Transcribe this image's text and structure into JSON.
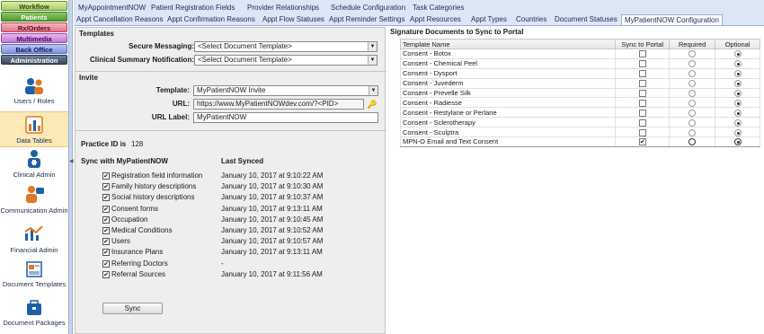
{
  "nav": {
    "tabs": [
      "Workflow",
      "Patients",
      "Rx/Orders",
      "Multimedia",
      "Back Office",
      "Administration"
    ],
    "items": [
      {
        "label": "Users / Roles",
        "icon": "users-icon"
      },
      {
        "label": "Data Tables",
        "icon": "data-tables-icon"
      },
      {
        "label": "Clinical Admin",
        "icon": "clinical-admin-icon"
      },
      {
        "label": "Communication Admin",
        "icon": "communication-admin-icon"
      },
      {
        "label": "Financial Admin",
        "icon": "financial-admin-icon"
      },
      {
        "label": "Document Templates",
        "icon": "document-templates-icon"
      },
      {
        "label": "Document Packages",
        "icon": "document-packages-icon"
      }
    ]
  },
  "tabs": {
    "row1": [
      "MyAppointmentNOW",
      "Patient Registration Fields",
      "Provider Relationships",
      "Schedule Configuration",
      "Task Categories"
    ],
    "row2": [
      "Appt Cancellation Reasons",
      "Appt Confirmation Reasons",
      "Appt Flow Statuses",
      "Appt Reminder Settings",
      "Appt Resources",
      "Appt Types",
      "Countries",
      "Document Statuses",
      "MyPatientNOW Configuration"
    ]
  },
  "templates": {
    "heading": "Templates",
    "secure_label": "Secure Messaging:",
    "secure_value": "<Select Document Template>",
    "summary_label": "Clinical Summary Notification:",
    "summary_value": "<Select Document Template>"
  },
  "invite": {
    "heading": "Invite",
    "template_label": "Template:",
    "template_value": "MyPatientNOW Invite",
    "url_label": "URL:",
    "url_value": "https://www.MyPatientNOWdev.com/?<PID>",
    "urllabel_label": "URL Label:",
    "urllabel_value": "MyPatientNOW"
  },
  "practice": {
    "label": "Practice ID is",
    "value": "128"
  },
  "sync": {
    "col_header": "Sync with MyPatientNOW",
    "last_header": "Last Synced",
    "items": [
      {
        "name": "Registration field information",
        "checked": true,
        "last": "January 10, 2017 at 9:10:22 AM"
      },
      {
        "name": "Family history descriptions",
        "checked": true,
        "last": "January 10, 2017 at 9:10:30 AM"
      },
      {
        "name": "Social history descriptions",
        "checked": true,
        "last": "January 10, 2017 at 9:10:37 AM"
      },
      {
        "name": "Consent forms",
        "checked": true,
        "last": "January 10, 2017 at 9:13:11 AM"
      },
      {
        "name": "Occupation",
        "checked": true,
        "last": "January 10, 2017 at 9:10:45 AM"
      },
      {
        "name": "Medical Conditions",
        "checked": true,
        "last": "January 10, 2017 at 9:10:52 AM"
      },
      {
        "name": "Users",
        "checked": true,
        "last": "January 10, 2017 at 9:10:57 AM"
      },
      {
        "name": "Insurance Plans",
        "checked": true,
        "last": "January 10, 2017 at 9:13:11 AM"
      },
      {
        "name": "Referring Doctors",
        "checked": true,
        "last": "-"
      },
      {
        "name": "Referral Sources",
        "checked": true,
        "last": "January 10, 2017 at 9:11:56 AM"
      }
    ],
    "button": "Sync"
  },
  "signature": {
    "title": "Signature Documents to Sync to Portal",
    "columns": [
      "Template Name",
      "Sync to Portal",
      "Required",
      "Optional"
    ],
    "rows": [
      {
        "name": "Consent - Botox",
        "sync": false,
        "choice": "optional"
      },
      {
        "name": "Consent - Chemical Peel",
        "sync": false,
        "choice": "optional"
      },
      {
        "name": "Consent - Dysport",
        "sync": false,
        "choice": "optional"
      },
      {
        "name": "Consent - Juvederm",
        "sync": false,
        "choice": "optional"
      },
      {
        "name": "Consent - Prevelle Silk",
        "sync": false,
        "choice": "optional"
      },
      {
        "name": "Consent - Radiesse",
        "sync": false,
        "choice": "optional"
      },
      {
        "name": "Consent - Restylane or Perlane",
        "sync": false,
        "choice": "optional"
      },
      {
        "name": "Consent - Sclerotherapy",
        "sync": false,
        "choice": "optional"
      },
      {
        "name": "Consent - Sculptra",
        "sync": false,
        "choice": "optional"
      },
      {
        "name": "MPN-O Email and Text Consent",
        "sync": true,
        "choice": "optional"
      }
    ]
  },
  "colors": {
    "nav_border": "#9bb0d4",
    "tab_bg": "#dce6f4",
    "selected_nav": "#fbe9b8",
    "panel_bg": "#eeeeee"
  }
}
